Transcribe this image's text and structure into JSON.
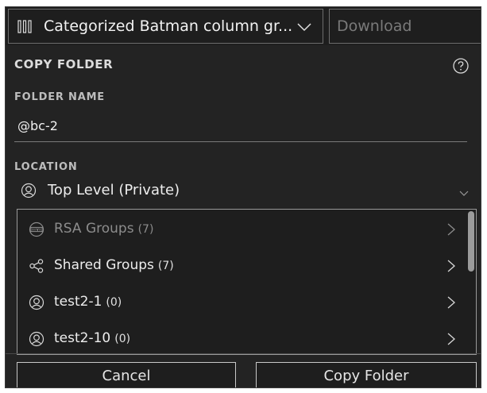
{
  "header": {
    "group_select_label": "Categorized Batman column gr...",
    "download_placeholder": "Download"
  },
  "dialog": {
    "title": "COPY FOLDER",
    "folder_name_label": "FOLDER NAME",
    "folder_name_value": "@bc-2",
    "location_label": "LOCATION",
    "location_value": "Top Level (Private)"
  },
  "folder_list": {
    "items": [
      {
        "label": "RSA Groups",
        "count": "(7)",
        "icon": "live-icon",
        "disabled": true
      },
      {
        "label": "Shared Groups",
        "count": "(7)",
        "icon": "share-icon",
        "disabled": false
      },
      {
        "label": "test2-1",
        "count": "(0)",
        "icon": "user-icon",
        "disabled": false
      },
      {
        "label": "test2-10",
        "count": "(0)",
        "icon": "user-icon",
        "disabled": false
      }
    ]
  },
  "buttons": {
    "cancel_label": "Cancel",
    "copy_label": "Copy Folder"
  },
  "colors": {
    "background": "#1e1e1e",
    "dialog": "#232323",
    "border": "#9a9a9a",
    "text": "#e6e6e6",
    "accent_mark": "#c9a200"
  }
}
